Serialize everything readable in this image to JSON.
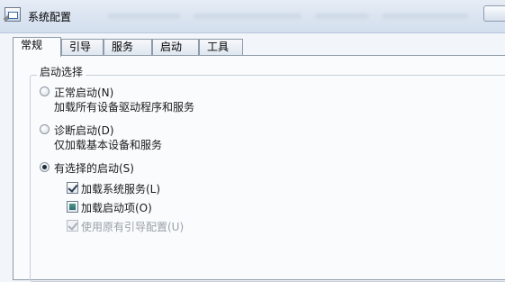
{
  "window": {
    "title": "系统配置"
  },
  "tabs": [
    {
      "label": "常规",
      "active": true
    },
    {
      "label": "引导",
      "active": false
    },
    {
      "label": "服务",
      "active": false
    },
    {
      "label": "启动",
      "active": false
    },
    {
      "label": "工具",
      "active": false
    }
  ],
  "startup": {
    "group_label": "启动选择",
    "options": [
      {
        "label": "正常启动(N)",
        "description": "加载所有设备驱动程序和服务",
        "selected": false
      },
      {
        "label": "诊断启动(D)",
        "description": "仅加载基本设备和服务",
        "selected": false
      },
      {
        "label": "有选择的启动(S)",
        "selected": true
      }
    ],
    "selective": [
      {
        "label": "加载系统服务(L)",
        "state": "checked",
        "enabled": true
      },
      {
        "label": "加载启动项(O)",
        "state": "indeterminate",
        "enabled": true
      },
      {
        "label": "使用原有引导配置(U)",
        "state": "checked",
        "enabled": false
      }
    ]
  },
  "colors": {
    "titlebar": "#dce5f1",
    "panel": "#f9fbfd",
    "border": "#8e9aa8",
    "disabled_text": "#9aa1a9"
  }
}
